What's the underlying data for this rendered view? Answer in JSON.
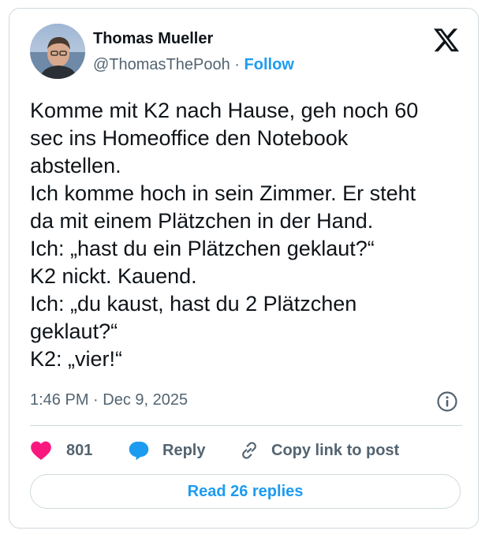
{
  "author": {
    "name": "Thomas Mueller",
    "handle": "@ThomasThePooh",
    "separator": "·",
    "follow_label": "Follow",
    "avatar_icon": "avatar-photo"
  },
  "platform_icon": "x-logo-icon",
  "tweet": {
    "lines": [
      "Komme mit K2 nach Hause, geh noch 60",
      "sec ins Homeoffice den Notebook",
      "abstellen.",
      "Ich komme hoch in sein Zimmer. Er steht",
      "da mit einem Plätzchen in der Hand.",
      "Ich: „hast du ein Plätzchen geklaut?“",
      "K2 nickt. Kauend.",
      "Ich: „du kaust, hast du 2 Plätzchen",
      "geklaut?“",
      "K2: „vier!“"
    ],
    "time": "1:46 PM",
    "separator": "·",
    "date": "Dec 9, 2025"
  },
  "actions": {
    "like_count": "801",
    "reply_label": "Reply",
    "copy_label": "Copy link to post"
  },
  "read_replies_label": "Read 26 replies",
  "colors": {
    "accent": "#1d9bf0",
    "heart": "#f91880",
    "text": "#0f1419",
    "muted": "#536471",
    "border": "#cfd9de"
  }
}
